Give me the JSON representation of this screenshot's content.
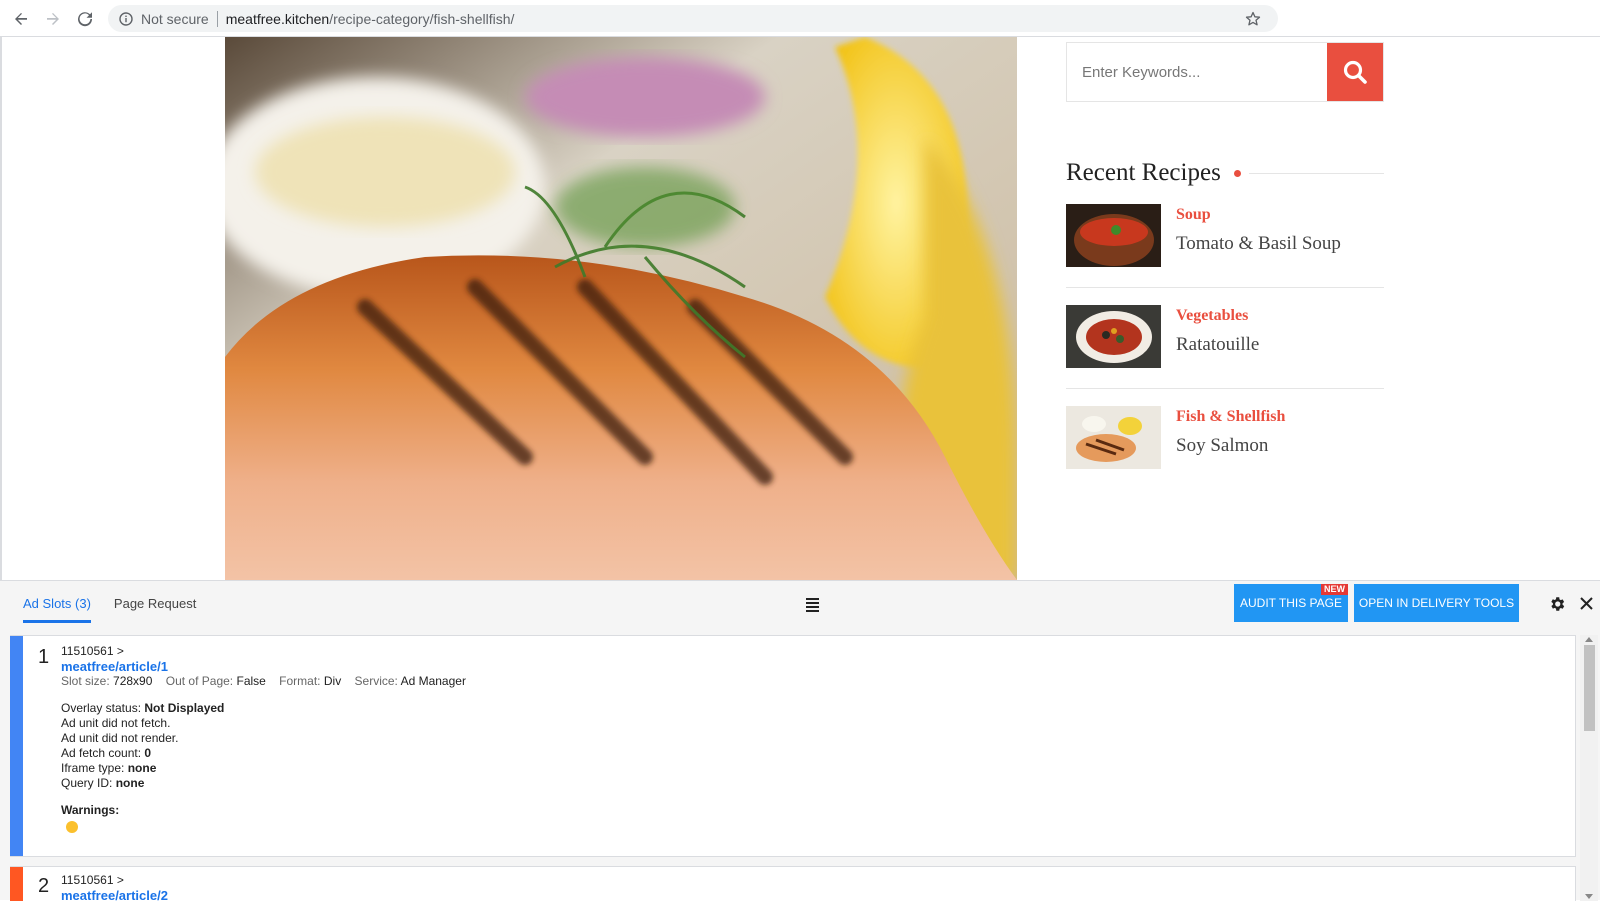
{
  "browser": {
    "security_label": "Not secure",
    "url_host": "meatfree.kitchen",
    "url_path": "/recipe-category/fish-shellfish/"
  },
  "search": {
    "placeholder": "Enter Keywords..."
  },
  "sidebar": {
    "recent_title": "Recent Recipes",
    "recipes": [
      {
        "category": "Soup",
        "name": "Tomato & Basil Soup"
      },
      {
        "category": "Vegetables",
        "name": "Ratatouille"
      },
      {
        "category": "Fish & Shellfish",
        "name": "Soy Salmon"
      }
    ]
  },
  "console": {
    "tabs": [
      "Ad Slots (3)",
      "Page Request"
    ],
    "audit_label": "AUDIT THIS PAGE",
    "new_badge": "NEW",
    "delivery_label": "OPEN IN DELIVERY TOOLS",
    "slots": [
      {
        "index": "1",
        "network": "11510561 >",
        "path": "meatfree/article/1",
        "slot_size_key": "Slot size:",
        "slot_size": "728x90",
        "oop_key": "Out of Page:",
        "oop": "False",
        "format_key": "Format:",
        "format": "Div",
        "service_key": "Service:",
        "service": "Ad Manager",
        "overlay_key": "Overlay status:",
        "overlay": "Not Displayed",
        "fetch_msg": "Ad unit did not fetch.",
        "render_msg": "Ad unit did not render.",
        "fetch_count_key": "Ad fetch count:",
        "fetch_count": "0",
        "iframe_key": "Iframe type:",
        "iframe": "none",
        "query_key": "Query ID:",
        "query": "none",
        "warnings_label": "Warnings:"
      },
      {
        "index": "2",
        "network": "11510561 >",
        "path": "meatfree/article/2"
      }
    ]
  },
  "colors": {
    "accent": "#e94f3f",
    "console_blue": "#2196f3",
    "slot1_bar": "#4285f4",
    "slot2_bar": "#ff5722"
  }
}
